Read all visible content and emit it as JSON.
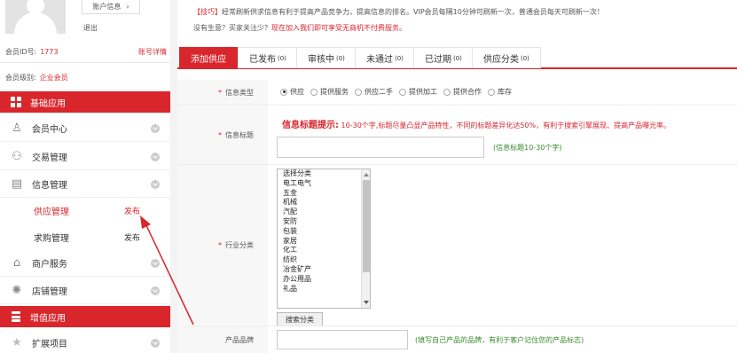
{
  "sidebar": {
    "account_button": "账户信息",
    "logout": "退出",
    "member_id_label": "会员ID号:",
    "member_id": "1773",
    "account_detail_link": "账号详情",
    "member_level_label": "会员级别:",
    "member_level": "企业会员",
    "section_basic": "基础应用",
    "section_value": "增值应用",
    "items": [
      {
        "label": "会员中心"
      },
      {
        "label": "交易管理"
      },
      {
        "label": "信息管理"
      },
      {
        "label": "商户服务"
      },
      {
        "label": "店铺管理"
      },
      {
        "label": "扩展项目"
      }
    ],
    "sub_items": [
      {
        "label": "供应管理",
        "action": "发布"
      },
      {
        "label": "求购管理",
        "action": "发布"
      }
    ],
    "colors": {
      "accent": "#d9262c"
    }
  },
  "tips": {
    "line1_prefix": "【技巧】",
    "line1": "经常刷新供求信息有利于提高产品竞争力，提高信息的排名。VIP会员每隔10分钟可刷新一次，普通会员每天可刷新一次！",
    "line2_prefix": "没有生意？买家关注少？",
    "line2": "现在加入我们即可享受无商机不付费服务。"
  },
  "tabs": [
    {
      "label": "添加供应",
      "count": ""
    },
    {
      "label": "已发布",
      "count": "(0)"
    },
    {
      "label": "审核中",
      "count": "(0)"
    },
    {
      "label": "未通过",
      "count": "(0)"
    },
    {
      "label": "已过期",
      "count": "(0)"
    },
    {
      "label": "供应分类",
      "count": "(0)"
    }
  ],
  "form": {
    "info_type_label": "信息类型",
    "info_types": [
      "供应",
      "提供服务",
      "供应二手",
      "提供加工",
      "提供合作",
      "库存"
    ],
    "title_label": "信息标题",
    "title_hint_head": "信息标题提示:",
    "title_hint": "10-30个字,标题尽量凸显产品特性，不同的标题差异化达50%，有利于搜索引擎展现、提高产品曝光率。",
    "title_value": "",
    "title_note": "(信息标题10-30个字)",
    "industry_label": "行业分类",
    "industry_options": [
      "选择分类",
      "电工电气",
      "五金",
      "机械",
      "汽配",
      "安防",
      "包装",
      "家居",
      "化工",
      "纺织",
      "冶金矿产",
      "办公用品",
      "礼品"
    ],
    "search_button": "搜索分类",
    "brand_label": "产品品牌",
    "brand_value": "",
    "brand_note": "(填写自己产品的品牌，有利于客户记住您的产品标志)"
  }
}
